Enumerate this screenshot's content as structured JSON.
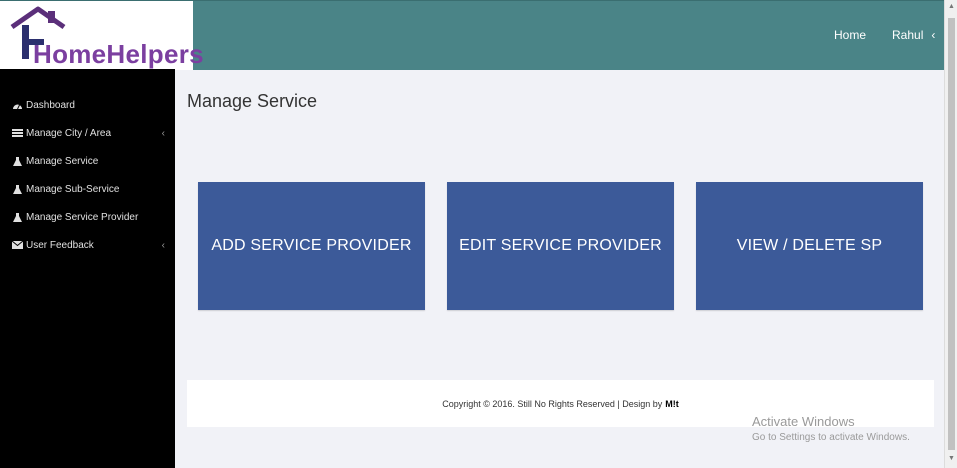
{
  "header": {
    "logo_text": "HomeHelpers",
    "nav_home": "Home",
    "nav_user": "Rahul"
  },
  "sidebar": {
    "items": [
      {
        "label": "Dashboard",
        "icon": "dashboard-icon",
        "has_arrow": false
      },
      {
        "label": "Manage City / Area",
        "icon": "list-icon",
        "has_arrow": true
      },
      {
        "label": "Manage Service",
        "icon": "flask-icon",
        "has_arrow": false
      },
      {
        "label": "Manage Sub-Service",
        "icon": "flask-icon",
        "has_arrow": false
      },
      {
        "label": "Manage Service Provider",
        "icon": "flask-icon",
        "has_arrow": false
      },
      {
        "label": "User Feedback",
        "icon": "envelope-icon",
        "has_arrow": true
      }
    ]
  },
  "main": {
    "title": "Manage Service",
    "tiles": [
      {
        "label": "ADD SERVICE PROVIDER"
      },
      {
        "label": "EDIT SERVICE PROVIDER"
      },
      {
        "label": "VIEW / DELETE SP"
      }
    ]
  },
  "footer": {
    "text": "Copyright © 2016. Still No Rights Reserved | Design by",
    "brand": "M!t"
  },
  "watermark": {
    "line1": "Activate Windows",
    "line2": "Go to Settings to activate Windows."
  },
  "colors": {
    "topbar": "#4a8487",
    "sidebar": "#000000",
    "tile": "#3c5a99",
    "logo_purple": "#7b3fa0"
  }
}
